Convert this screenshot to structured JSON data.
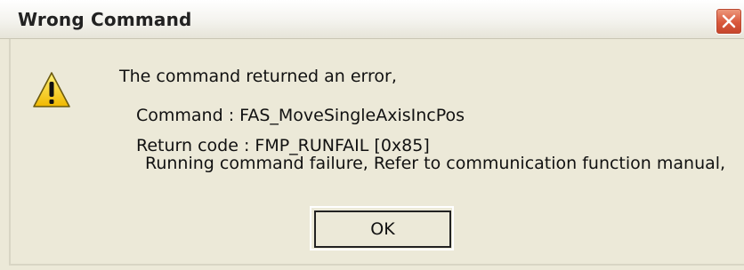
{
  "window": {
    "title": "Wrong Command",
    "close_icon": "close-x-icon"
  },
  "message": {
    "icon": "warning-icon",
    "header": "The command returned an error,",
    "command_line": "Command : FAS_MoveSingleAxisIncPos",
    "return_code_line": "Return code : FMP_RUNFAIL [0x85]",
    "return_desc_line": "Running command failure, Refer to communication function manual,"
  },
  "buttons": {
    "ok_label": "OK"
  },
  "colors": {
    "dialog_bg": "#ece9d8",
    "close_red": "#d9583c",
    "warning_yellow": "#ffd21a"
  }
}
